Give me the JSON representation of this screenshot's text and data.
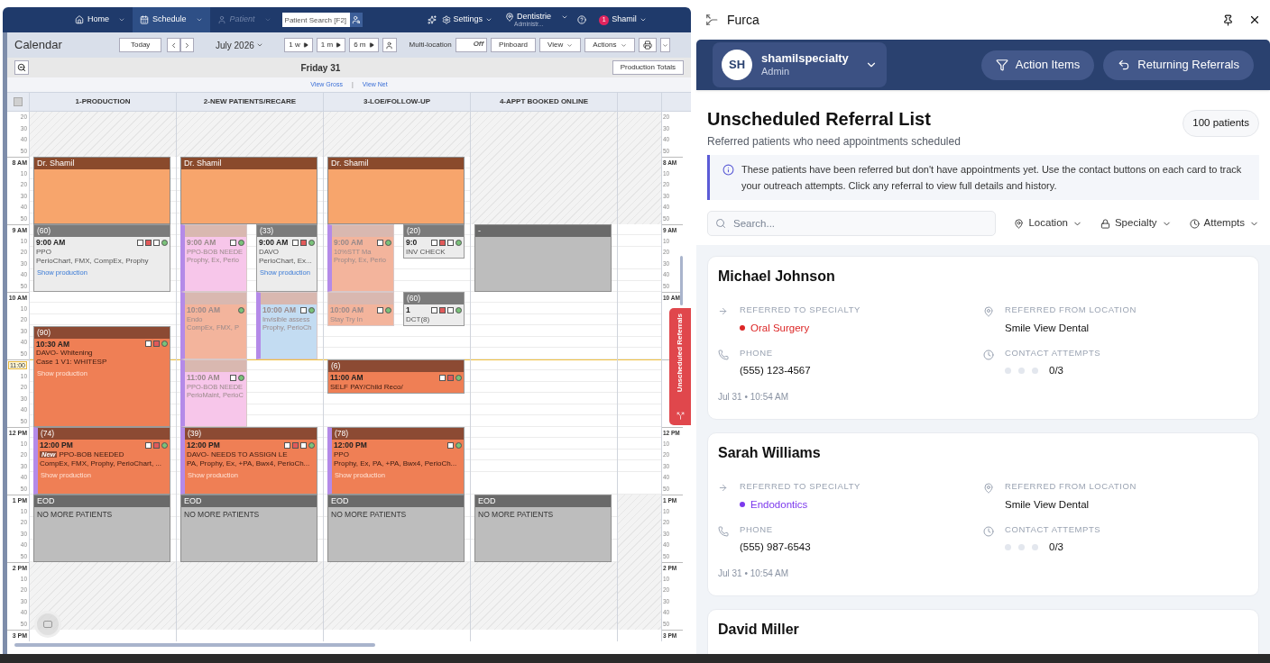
{
  "nav": {
    "items": [
      {
        "label": "Home",
        "selected": false,
        "disabled": false
      },
      {
        "label": "Schedule",
        "selected": true,
        "disabled": false
      },
      {
        "label": "Patient",
        "selected": false,
        "disabled": true
      }
    ],
    "search_placeholder": "Patient Search [F2]",
    "settings": "Settings",
    "location": "Dentistrie",
    "location_sub": "Administr...",
    "user_badge": "1",
    "user": "Shamil"
  },
  "toolbar": {
    "title": "Calendar",
    "today": "Today",
    "month": "July 2026",
    "ranges": [
      "1 w",
      "1 m",
      "6 m"
    ],
    "multi_label": "Multi-location",
    "toggle": {
      "label": "Off",
      "on": false
    },
    "buttons": [
      {
        "label": "Pinboard",
        "menu": false
      },
      {
        "label": "View",
        "menu": true
      },
      {
        "label": "Actions",
        "menu": true
      }
    ]
  },
  "day": "Friday 31",
  "select_all": {
    "checked": false
  },
  "production_totals": "Production Totals",
  "links": [
    "View Gross",
    "View Net"
  ],
  "link_separator": "|",
  "columns": [
    {
      "title": "1-PRODUCTION",
      "appointments": [
        {
          "kind": "provider",
          "header": "Dr. Shamil",
          "color": "#f7a56c"
        },
        {
          "kind": "appointment",
          "header": "(60)",
          "time": "9:00 AM",
          "lines": [
            "PPO",
            "PerioChart, FMX, CompEx, Prophy"
          ],
          "link": "Show production",
          "color": "#ececec",
          "faded": false,
          "flagged": false
        },
        {
          "kind": "appointment",
          "header": "(90)",
          "time": "10:30 AM",
          "lines": [
            "DAVO- Whitening",
            "Case 1 V1: WHITESP"
          ],
          "link": "Show production",
          "color": "#ef7f55",
          "faded": false,
          "flagged": false
        },
        {
          "kind": "appointment",
          "header": "(74)",
          "time": "12:00 PM",
          "badge": "New",
          "lines": [
            "PPO-BOB NEEDED",
            "CompEx, FMX, Prophy, PerioChart, ..."
          ],
          "link": "Show production",
          "color": "#ef7f55",
          "faded": false,
          "flagged": true
        },
        {
          "kind": "block",
          "header": "EOD",
          "lines": [
            "NO MORE PATIENTS"
          ],
          "color": "#bdbdbd"
        }
      ]
    },
    {
      "title": "2-NEW PATIENTS/RECARE",
      "appointments": [
        {
          "kind": "provider",
          "header": "Dr. Shamil",
          "color": "#f7a56c"
        },
        {
          "kind": "appointment",
          "header": "(33)",
          "time": "9:00 AM",
          "lines": [
            "DAVO",
            "PerioChart, Ex..."
          ],
          "link": "Show production",
          "color": "#ececec",
          "faded": false,
          "flagged": false
        },
        {
          "kind": "appointment",
          "header": "(39)",
          "time": "12:00 PM",
          "lines": [
            "DAVO- NEEDS TO ASSIGN LE",
            "PA, Prophy, Ex, +PA, Bwx4, PerioCh..."
          ],
          "link": "Show production",
          "color": "#ef7f55",
          "faded": false,
          "flagged": true
        },
        {
          "kind": "block",
          "header": "EOD",
          "lines": [
            "NO MORE PATIENTS"
          ],
          "color": "#bdbdbd"
        }
      ],
      "faded_appointments": [
        {
          "time": "9:00 AM",
          "lines": [
            "PPO-BOB NEEDE",
            "Prophy, Ex, Perio"
          ],
          "color": "#f7c6ea",
          "flagged": true
        },
        {
          "time": "10:00 AM",
          "lines": [
            "Endo",
            "CompEx, FMX, P"
          ],
          "color": "#f3b49c",
          "flagged": true
        },
        {
          "time": "10:00 AM",
          "lines": [
            "Invisible assess",
            "Prophy, PerioCh"
          ],
          "color": "#c3dcf2",
          "flagged": true
        },
        {
          "time": "11:00 AM",
          "lines": [
            "PPO-BOB NEEDE",
            "PerioMaint, PerioC"
          ],
          "color": "#f7c6ea",
          "flagged": true
        }
      ]
    },
    {
      "title": "3-LOE/FOLLOW-UP",
      "appointments": [
        {
          "kind": "provider",
          "header": "Dr. Shamil",
          "color": "#f7a56c"
        },
        {
          "kind": "appointment",
          "header": "(20)",
          "time": "9:0",
          "lines": [
            "INV CHECK"
          ],
          "color": "#ececec",
          "faded": false,
          "flagged": false
        },
        {
          "kind": "appointment",
          "header": "(60)",
          "time": "1",
          "lines": [
            "DCT(8)"
          ],
          "color": "#ececec",
          "faded": false,
          "flagged": false
        },
        {
          "kind": "appointment",
          "header": "(6)",
          "time": "11:00 AM",
          "lines": [
            "SELF PAY/Child Reco/"
          ],
          "color": "#ef7f55",
          "faded": false,
          "flagged": false
        },
        {
          "kind": "appointment",
          "header": "(78)",
          "time": "12:00 PM",
          "lines": [
            "PPO",
            "Prophy, Ex, PA, +PA, Bwx4, PerioCh..."
          ],
          "link": "Show production",
          "color": "#ef7f55",
          "faded": false,
          "flagged": true
        },
        {
          "kind": "block",
          "header": "EOD",
          "lines": [
            "NO MORE PATIENTS"
          ],
          "color": "#bdbdbd"
        }
      ],
      "faded_appointments": [
        {
          "time": "9:00 AM",
          "lines": [
            "10%STT Ma",
            "Prophy, Ex, Perio"
          ],
          "color": "#f3b49c",
          "flagged": true
        },
        {
          "time": "10:00 AM",
          "lines": [
            "Stay Try In"
          ],
          "color": "#f3b49c",
          "flagged": false
        }
      ]
    },
    {
      "title": "4-APPT BOOKED ONLINE",
      "appointments": [
        {
          "kind": "block",
          "header": "-",
          "color": "#bdbdbd"
        },
        {
          "kind": "block",
          "header": "EOD",
          "lines": [
            "NO MORE PATIENTS"
          ],
          "color": "#bdbdbd"
        }
      ]
    }
  ],
  "time_rows": [
    {
      "label": "20",
      "right_label": "20"
    },
    {
      "label": "30",
      "right_label": "30"
    },
    {
      "label": "40",
      "right_label": "40"
    },
    {
      "label": "50",
      "right_label": "50"
    },
    {
      "label": "8 AM",
      "right_label": "8 AM",
      "hour": true
    },
    {
      "label": "10",
      "right_label": "10"
    },
    {
      "label": "20",
      "right_label": "20"
    },
    {
      "label": "30",
      "right_label": "30"
    },
    {
      "label": "40",
      "right_label": "40"
    },
    {
      "label": "50",
      "right_label": "50"
    },
    {
      "label": "9 AM",
      "right_label": "9 AM",
      "hour": true
    },
    {
      "label": "10",
      "right_label": "10"
    },
    {
      "label": "20",
      "right_label": "20"
    },
    {
      "label": "30",
      "right_label": "30"
    },
    {
      "label": "40",
      "right_label": "40"
    },
    {
      "label": "50",
      "right_label": "50"
    },
    {
      "label": "10 AM",
      "right_label": "10 AM",
      "hour": true
    },
    {
      "label": "10"
    },
    {
      "label": "20"
    },
    {
      "label": "30"
    },
    {
      "label": "40"
    },
    {
      "label": "50"
    },
    {
      "label": "11:00",
      "hour": true,
      "now": true
    },
    {
      "label": "10"
    },
    {
      "label": "20"
    },
    {
      "label": "30"
    },
    {
      "label": "40"
    },
    {
      "label": "50"
    },
    {
      "label": "12 PM",
      "right_label": "12 PM",
      "hour": true
    },
    {
      "label": "10",
      "right_label": "10"
    },
    {
      "label": "20",
      "right_label": "20"
    },
    {
      "label": "30",
      "right_label": "30"
    },
    {
      "label": "40",
      "right_label": "40"
    },
    {
      "label": "50",
      "right_label": "50"
    },
    {
      "label": "1 PM",
      "right_label": "1 PM",
      "hour": true
    },
    {
      "label": "10",
      "right_label": "10"
    },
    {
      "label": "20",
      "right_label": "20"
    },
    {
      "label": "30",
      "right_label": "30"
    },
    {
      "label": "40",
      "right_label": "40"
    },
    {
      "label": "50",
      "right_label": "50"
    },
    {
      "label": "2 PM",
      "right_label": "2 PM",
      "hour": true
    },
    {
      "label": "10",
      "right_label": "10"
    },
    {
      "label": "20",
      "right_label": "20"
    },
    {
      "label": "30",
      "right_label": "30"
    },
    {
      "label": "40",
      "right_label": "40"
    },
    {
      "label": "50",
      "right_label": "50"
    },
    {
      "label": "3 PM",
      "right_label": "3 PM",
      "hour": true
    }
  ],
  "side_tab": "Unscheduled Referrals",
  "panel": {
    "title": "Furca",
    "account": {
      "initials": "SH",
      "name": "shamilspecialty",
      "role": "Admin"
    },
    "actions": [
      {
        "label": "Action Items",
        "kind": "filter"
      },
      {
        "label": "Returning Referrals",
        "kind": "return"
      }
    ],
    "heading": "Unscheduled Referral List",
    "subheading": "Referred patients who need appointments scheduled",
    "count": "100 patients",
    "info": "These patients have been referred but don't have appointments yet. Use the contact buttons on each card to track your outreach attempts. Click any referral to view full details and history.",
    "search_placeholder": "Search...",
    "filters": [
      {
        "label": "Location",
        "kind": "location"
      },
      {
        "label": "Specialty",
        "kind": "specialty"
      },
      {
        "label": "Attempts",
        "kind": "attempts"
      }
    ],
    "referrals": [
      {
        "name": "Michael Johnson",
        "specialty_label": "REFERRED TO SPECIALTY",
        "specialty": "Oral Surgery",
        "color": "#dc2626",
        "location_label": "REFERRED FROM LOCATION",
        "location": "Smile View Dental",
        "phone_label": "PHONE",
        "phone": "(555) 123-4567",
        "attempts_label": "CONTACT ATTEMPTS",
        "attempts": [
          {
            "done": false
          },
          {
            "done": false
          },
          {
            "done": false
          }
        ],
        "attempts_text": "0/3",
        "date": "Jul 31 • 10:54 AM"
      },
      {
        "name": "Sarah Williams",
        "specialty_label": "REFERRED TO SPECIALTY",
        "specialty": "Endodontics",
        "color": "#7c3aed",
        "location_label": "REFERRED FROM LOCATION",
        "location": "Smile View Dental",
        "phone_label": "PHONE",
        "phone": "(555) 987-6543",
        "attempts_label": "CONTACT ATTEMPTS",
        "attempts": [
          {
            "done": false
          },
          {
            "done": false
          },
          {
            "done": false
          }
        ],
        "attempts_text": "0/3",
        "date": "Jul 31 • 10:54 AM"
      },
      {
        "name": "David Miller"
      }
    ]
  }
}
